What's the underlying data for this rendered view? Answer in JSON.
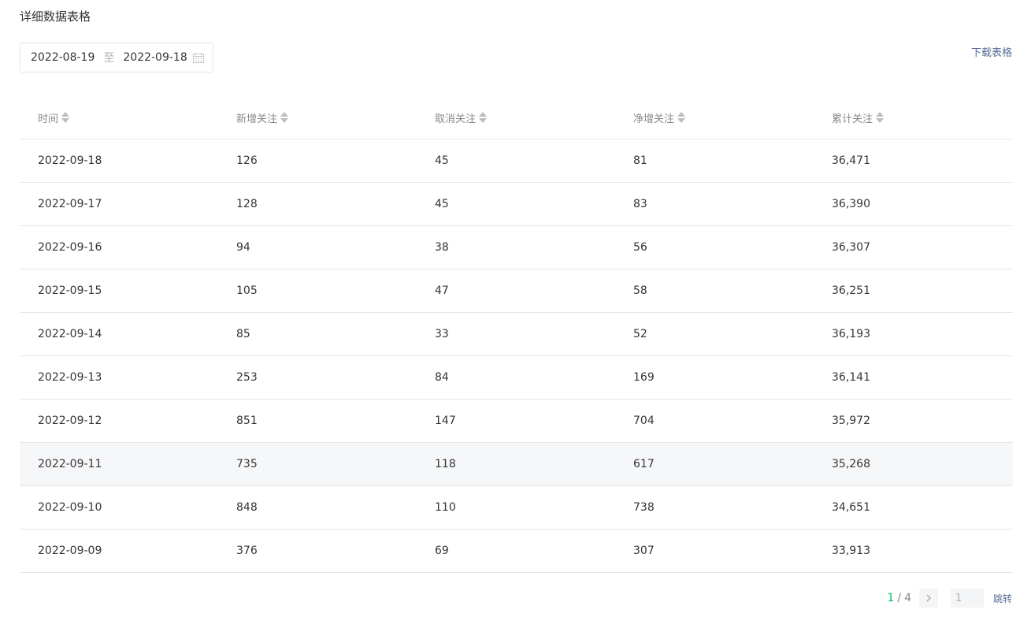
{
  "section": {
    "title": "详细数据表格"
  },
  "date_range": {
    "start": "2022-08-19",
    "separator": "至",
    "end": "2022-09-18",
    "icon": "calendar-icon"
  },
  "toolbar": {
    "download_label": "下载表格"
  },
  "table": {
    "headers": [
      "时间",
      "新增关注",
      "取消关注",
      "净增关注",
      "累计关注"
    ],
    "rows": [
      [
        "2022-09-18",
        "126",
        "45",
        "81",
        "36,471"
      ],
      [
        "2022-09-17",
        "128",
        "45",
        "83",
        "36,390"
      ],
      [
        "2022-09-16",
        "94",
        "38",
        "56",
        "36,307"
      ],
      [
        "2022-09-15",
        "105",
        "47",
        "58",
        "36,251"
      ],
      [
        "2022-09-14",
        "85",
        "33",
        "52",
        "36,193"
      ],
      [
        "2022-09-13",
        "253",
        "84",
        "169",
        "36,141"
      ],
      [
        "2022-09-12",
        "851",
        "147",
        "704",
        "35,972"
      ],
      [
        "2022-09-11",
        "735",
        "118",
        "617",
        "35,268"
      ],
      [
        "2022-09-10",
        "848",
        "110",
        "738",
        "34,651"
      ],
      [
        "2022-09-09",
        "376",
        "69",
        "307",
        "33,913"
      ]
    ],
    "highlighted_row": 7
  },
  "pagination": {
    "current": "1",
    "separator": "/",
    "total": "4",
    "input_placeholder": "1",
    "jump_label": "跳转"
  },
  "colors": {
    "accent": "#07c160",
    "link": "#576b95",
    "row_hover": "#f6f7f9"
  }
}
